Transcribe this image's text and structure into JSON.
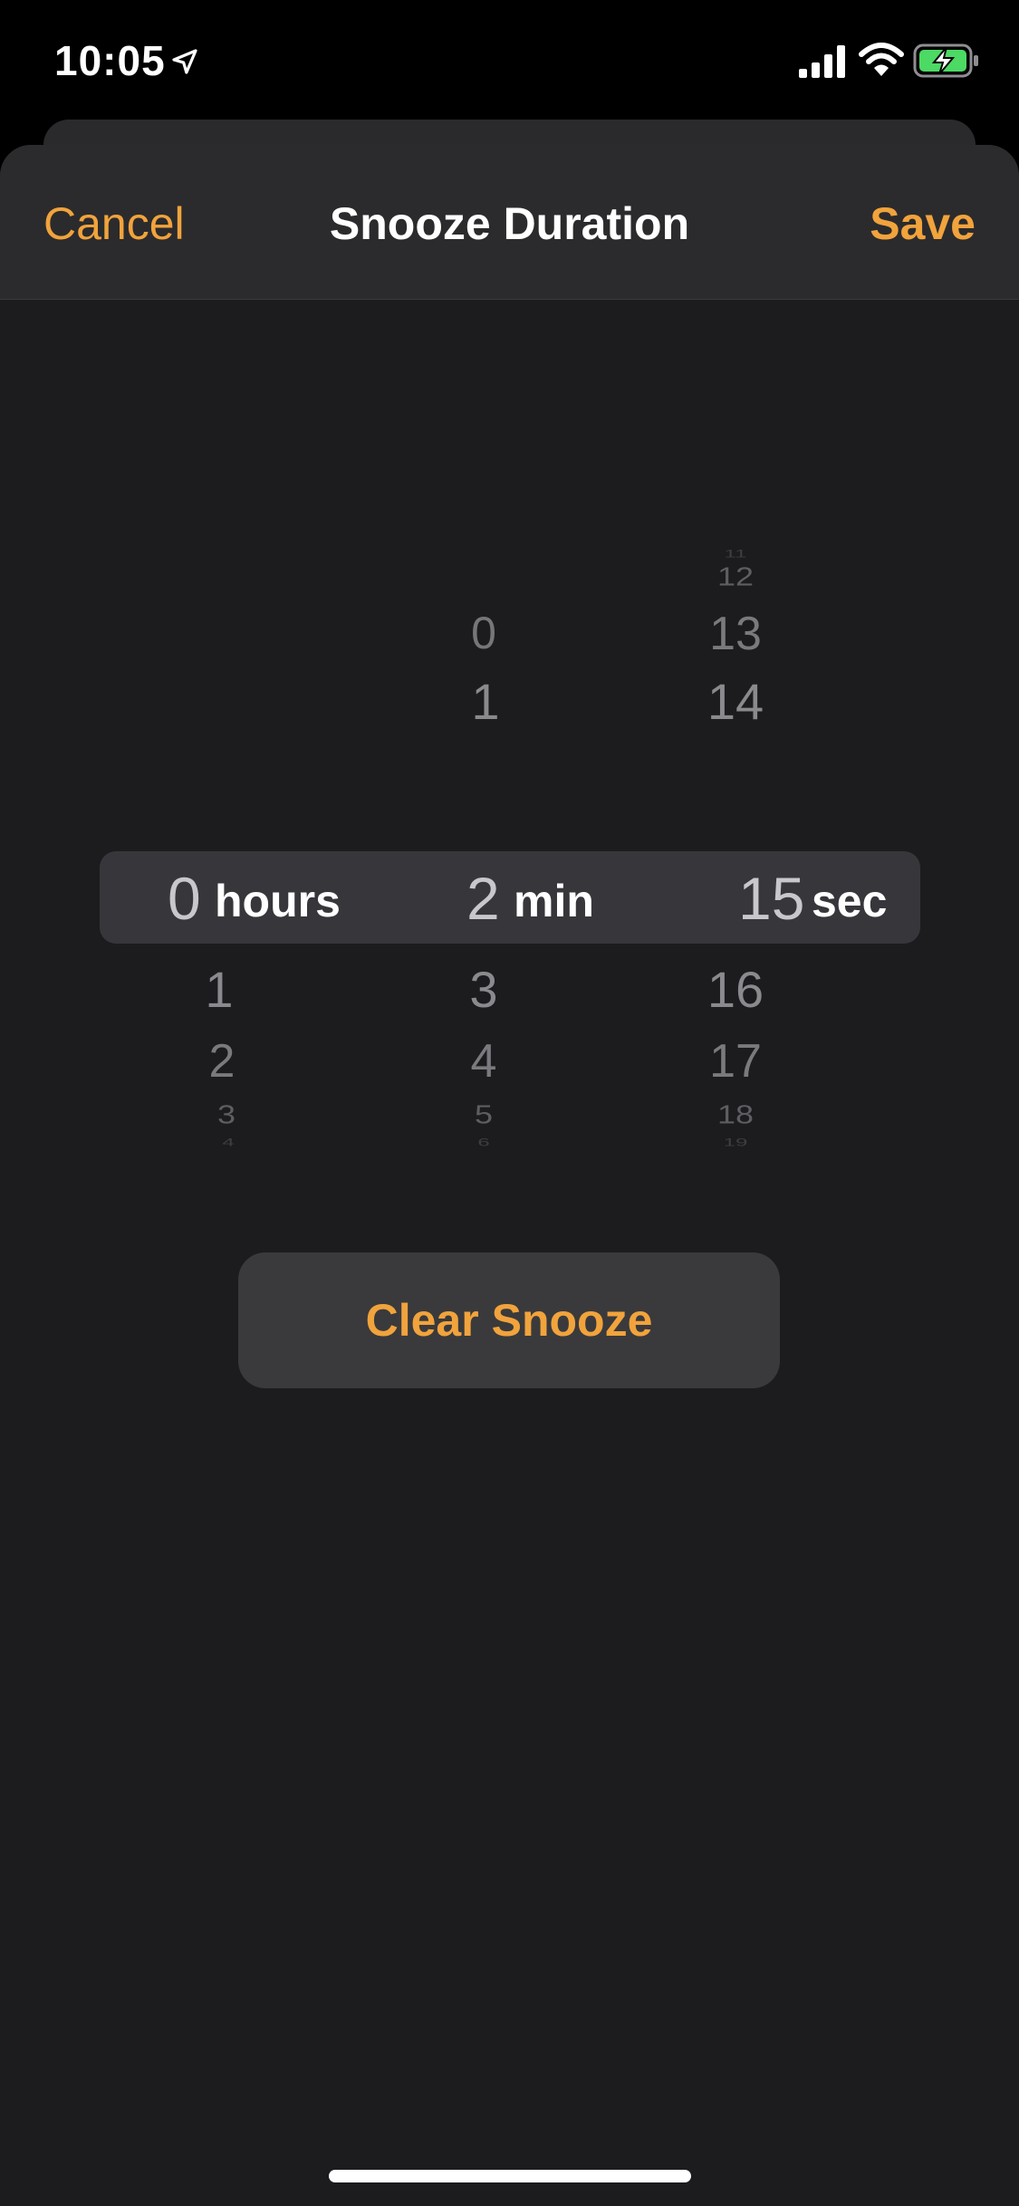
{
  "status_bar": {
    "time": "10:05"
  },
  "nav": {
    "cancel_label": "Cancel",
    "title": "Snooze Duration",
    "save_label": "Save"
  },
  "picker": {
    "hours": {
      "selected": "0",
      "unit": "hours",
      "below": [
        "1",
        "2",
        "3",
        "4"
      ]
    },
    "minutes": {
      "selected": "2",
      "unit": "min",
      "above": [
        "0",
        "1"
      ],
      "below": [
        "3",
        "4",
        "5",
        "6"
      ]
    },
    "seconds": {
      "selected": "15",
      "unit": "sec",
      "above": [
        "11",
        "12",
        "13",
        "14"
      ],
      "below": [
        "16",
        "17",
        "18",
        "19"
      ]
    }
  },
  "clear_label": "Clear Snooze",
  "colors": {
    "accent": "#F1A33C",
    "background": "#1C1C1E"
  }
}
